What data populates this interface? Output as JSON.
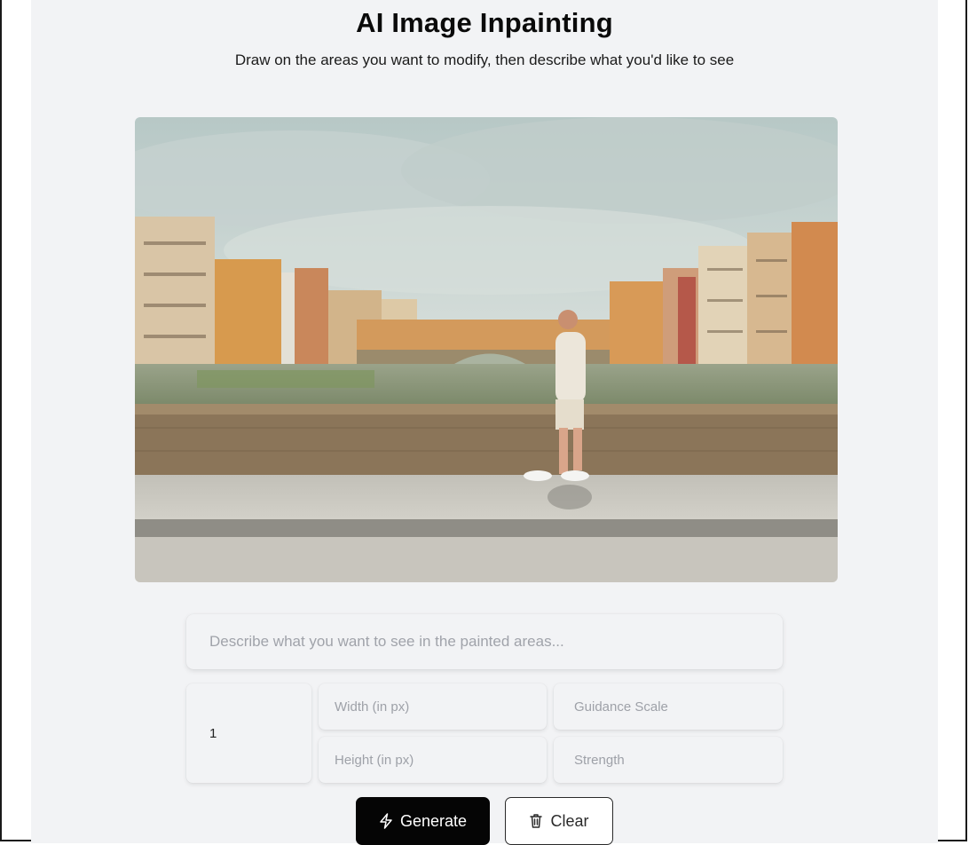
{
  "header": {
    "title": "AI Image Inpainting",
    "subtitle": "Draw on the areas you want to modify, then describe what you'd like to see"
  },
  "canvas": {
    "description_icon": "photo-canvas"
  },
  "form": {
    "prompt_placeholder": "Describe what you want to see in the painted areas...",
    "num_images_value": "1",
    "width_placeholder": "Width (in px)",
    "height_placeholder": "Height (in px)",
    "guidance_placeholder": "Guidance Scale",
    "strength_placeholder": "Strength"
  },
  "actions": {
    "generate_label": "Generate",
    "generate_icon": "lightning-icon",
    "clear_label": "Clear",
    "clear_icon": "trash-icon"
  },
  "colors": {
    "panel_bg": "#f2f3f5",
    "primary_button": "#050505"
  }
}
